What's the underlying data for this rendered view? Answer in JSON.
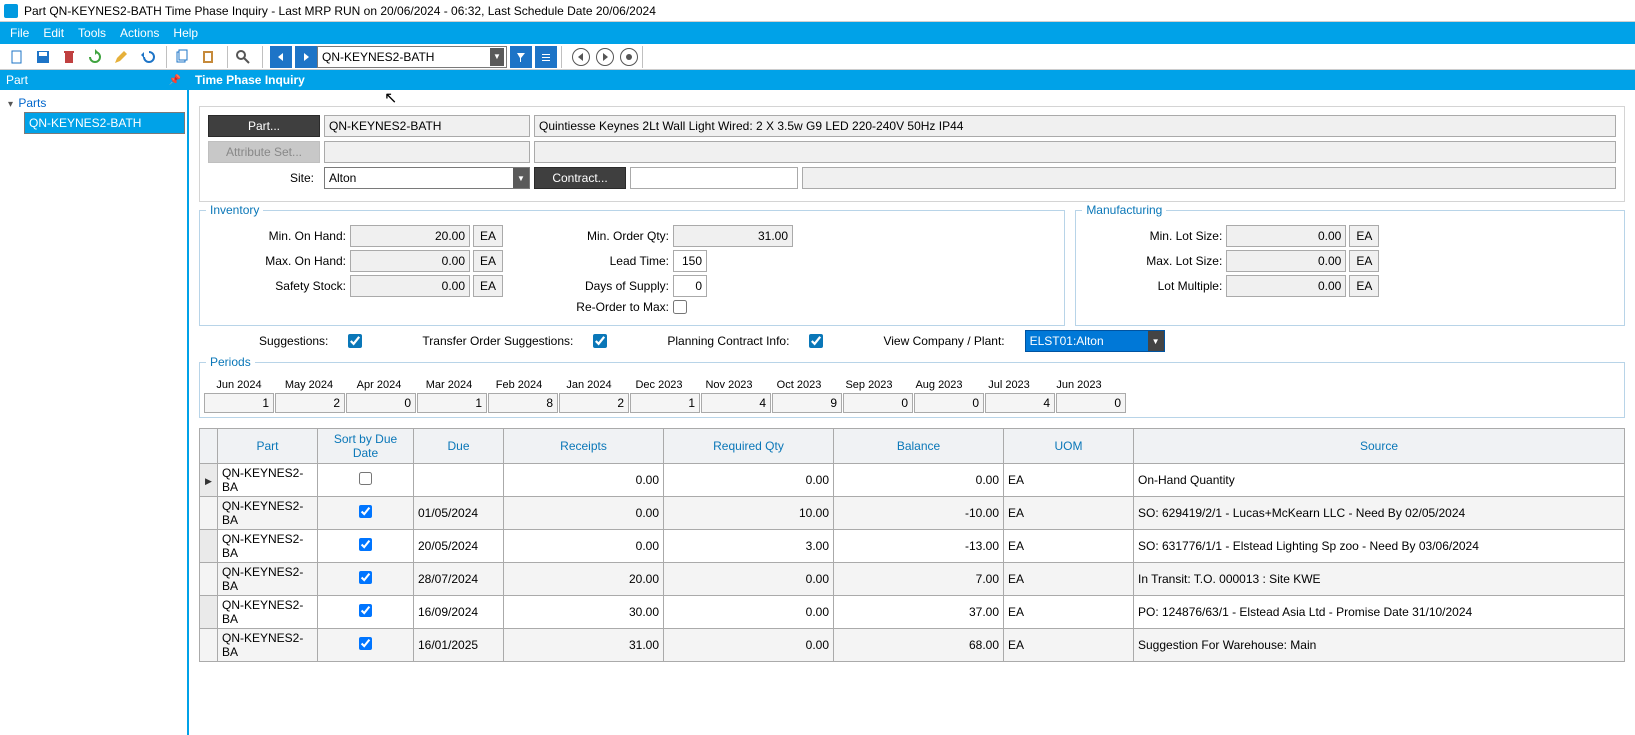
{
  "title": "Part QN-KEYNES2-BATH Time Phase Inquiry  - Last MRP RUN on 20/06/2024 - 06:32, Last Schedule Date  20/06/2024",
  "menu": {
    "file": "File",
    "edit": "Edit",
    "tools": "Tools",
    "actions": "Actions",
    "help": "Help"
  },
  "toolbar_combo": "QN-KEYNES2-BATH",
  "left": {
    "header": "Part",
    "root": "Parts",
    "node": "QN-KEYNES2-BATH"
  },
  "right_header": "Time Phase Inquiry",
  "form": {
    "part_btn": "Part...",
    "part_val": "QN-KEYNES2-BATH",
    "part_desc": "Quintiesse Keynes 2Lt Wall Light Wired: 2 X 3.5w G9 LED 220-240V 50Hz IP44",
    "attr_btn": "Attribute Set...",
    "site_lbl": "Site:",
    "site_val": "Alton",
    "contract_btn": "Contract..."
  },
  "inv": {
    "title": "Inventory",
    "min_oh_lbl": "Min. On Hand:",
    "min_oh": "20.00",
    "min_oh_u": "EA",
    "max_oh_lbl": "Max. On Hand:",
    "max_oh": "0.00",
    "max_oh_u": "EA",
    "ss_lbl": "Safety Stock:",
    "ss": "0.00",
    "ss_u": "EA",
    "moq_lbl": "Min. Order Qty:",
    "moq": "31.00",
    "lt_lbl": "Lead Time:",
    "lt": "150",
    "dos_lbl": "Days of Supply:",
    "dos": "0",
    "rom_lbl": "Re-Order to Max:"
  },
  "mfg": {
    "title": "Manufacturing",
    "min_lot_lbl": "Min. Lot Size:",
    "min_lot": "0.00",
    "min_lot_u": "EA",
    "max_lot_lbl": "Max. Lot Size:",
    "max_lot": "0.00",
    "max_lot_u": "EA",
    "mult_lbl": "Lot Multiple:",
    "mult": "0.00",
    "mult_u": "EA"
  },
  "opts": {
    "sugg_lbl": "Suggestions:",
    "to_lbl": "Transfer Order Suggestions:",
    "pc_lbl": "Planning Contract Info:",
    "vcp_lbl": "View Company / Plant:",
    "vcp_val": "ELST01:Alton"
  },
  "periods": {
    "title": "Periods",
    "heads": [
      "Jun 2024",
      "May 2024",
      "Apr 2024",
      "Mar 2024",
      "Feb 2024",
      "Jan 2024",
      "Dec 2023",
      "Nov 2023",
      "Oct 2023",
      "Sep 2023",
      "Aug 2023",
      "Jul 2023",
      "Jun 2023"
    ],
    "vals": [
      "1",
      "2",
      "0",
      "1",
      "8",
      "2",
      "1",
      "4",
      "9",
      "0",
      "0",
      "4",
      "0"
    ]
  },
  "grid": {
    "cols": {
      "part": "Part",
      "sort": "Sort by Due Date",
      "due": "Due",
      "receipts": "Receipts",
      "req": "Required Qty",
      "bal": "Balance",
      "uom": "UOM",
      "src": "Source"
    },
    "rows": [
      {
        "ptr": true,
        "part": "QN-KEYNES2-BA",
        "sort": false,
        "due": "",
        "receipts": "0.00",
        "req": "0.00",
        "bal": "0.00",
        "uom": "EA",
        "src": "On-Hand Quantity"
      },
      {
        "ptr": false,
        "part": "QN-KEYNES2-BA",
        "sort": true,
        "due": "01/05/2024",
        "receipts": "0.00",
        "req": "10.00",
        "bal": "-10.00",
        "uom": "EA",
        "src": "SO: 629419/2/1 - Lucas+McKearn LLC - Need By 02/05/2024"
      },
      {
        "ptr": false,
        "part": "QN-KEYNES2-BA",
        "sort": true,
        "due": "20/05/2024",
        "receipts": "0.00",
        "req": "3.00",
        "bal": "-13.00",
        "uom": "EA",
        "src": "SO: 631776/1/1 - Elstead Lighting Sp zoo - Need By 03/06/2024"
      },
      {
        "ptr": false,
        "part": "QN-KEYNES2-BA",
        "sort": true,
        "due": "28/07/2024",
        "receipts": "20.00",
        "req": "0.00",
        "bal": "7.00",
        "uom": "EA",
        "src": "In Transit: T.O. 000013 : Site KWE"
      },
      {
        "ptr": false,
        "part": "QN-KEYNES2-BA",
        "sort": true,
        "due": "16/09/2024",
        "receipts": "30.00",
        "req": "0.00",
        "bal": "37.00",
        "uom": "EA",
        "src": "PO: 124876/63/1 - Elstead Asia Ltd - Promise Date 31/10/2024"
      },
      {
        "ptr": false,
        "part": "QN-KEYNES2-BA",
        "sort": true,
        "due": "16/01/2025",
        "receipts": "31.00",
        "req": "0.00",
        "bal": "68.00",
        "uom": "EA",
        "src": "Suggestion For Warehouse: Main"
      }
    ]
  }
}
